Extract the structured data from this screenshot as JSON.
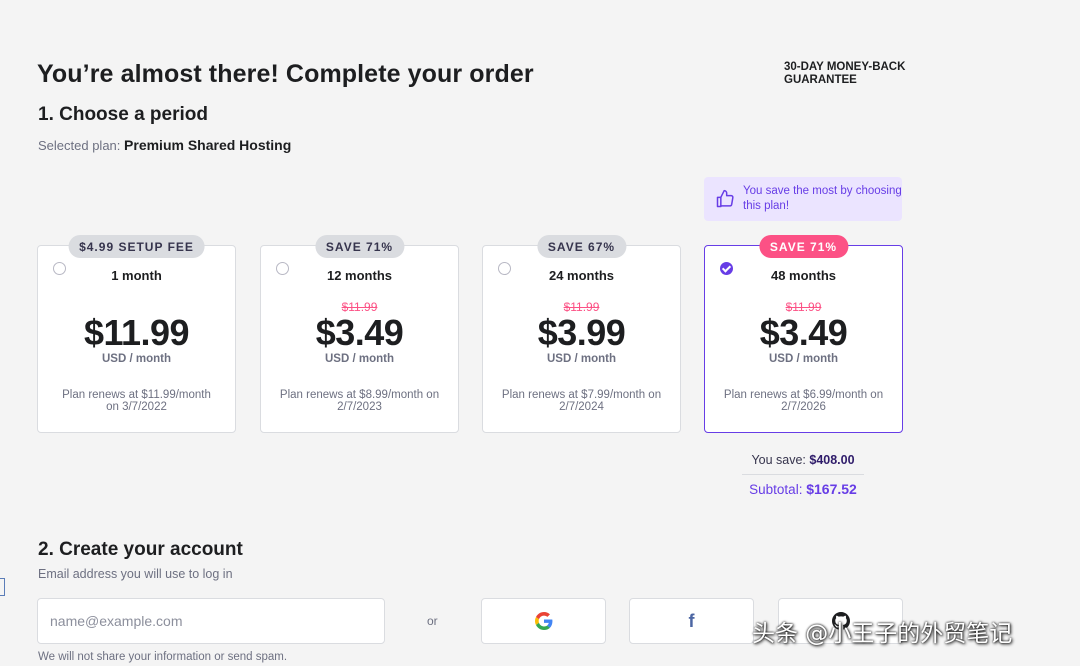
{
  "header": {
    "title": "You’re almost there! Complete your order",
    "guarantee": "30-DAY MONEY-BACK GUARANTEE"
  },
  "step1": {
    "title": "1. Choose a period",
    "selected_plan_label": "Selected plan:",
    "selected_plan_value": "Premium Shared Hosting",
    "tip": "You save the most by choosing this plan!",
    "plans": [
      {
        "badge": "$4.99 SETUP FEE",
        "period": "1 month",
        "old_price": "",
        "price": "$11.99",
        "unit": "USD / month",
        "renew": "Plan renews at $11.99/month on 3/7/2022",
        "selected": false
      },
      {
        "badge": "SAVE 71%",
        "period": "12 months",
        "old_price": "$11.99",
        "price": "$3.49",
        "unit": "USD / month",
        "renew": "Plan renews at $8.99/month on 2/7/2023",
        "selected": false
      },
      {
        "badge": "SAVE 67%",
        "period": "24 months",
        "old_price": "$11.99",
        "price": "$3.99",
        "unit": "USD / month",
        "renew": "Plan renews at $7.99/month on 2/7/2024",
        "selected": false
      },
      {
        "badge": "SAVE 71%",
        "period": "48 months",
        "old_price": "$11.99",
        "price": "$3.49",
        "unit": "USD / month",
        "renew": "Plan renews at $6.99/month on 2/7/2026",
        "selected": true
      }
    ],
    "savings_label": "You save:",
    "savings_value": "$408.00",
    "subtotal_label": "Subtotal:",
    "subtotal_value": "$167.52"
  },
  "step2": {
    "title": "2. Create your account",
    "hint": "Email address you will use to log in",
    "email_placeholder": "name@example.com",
    "or": "or",
    "google_icon": "google-icon",
    "facebook_icon": "facebook-icon",
    "github_icon": "github-icon",
    "disclaimer": "We will not share your information or send spam."
  },
  "watermark": "头条 @小王子的外贸笔记",
  "colors": {
    "accent": "#673de6",
    "badge_highlight": "#fc5185",
    "tip_background": "#ebe4ff",
    "text_dark": "#1d1e20",
    "text_muted": "#6d7081"
  }
}
